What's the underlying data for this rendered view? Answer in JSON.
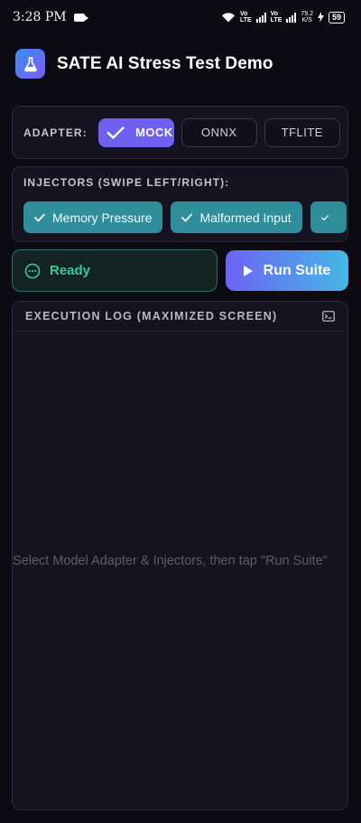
{
  "status_bar": {
    "time": "3:28 PM",
    "volte1": [
      "Vo",
      "LTE"
    ],
    "volte2": [
      "Vo",
      "LTE"
    ],
    "speed": [
      "79.2",
      "K/S"
    ],
    "battery": "59"
  },
  "header": {
    "title": "SATE AI Stress Test Demo",
    "logo_icon": "flask-icon"
  },
  "adapter": {
    "label": "ADAPTER:",
    "options": [
      {
        "label": "MOCK",
        "selected": true
      },
      {
        "label": "ONNX",
        "selected": false
      },
      {
        "label": "TFLITE",
        "selected": false
      }
    ]
  },
  "injectors": {
    "label": "INJECTORS (SWIPE LEFT/RIGHT):",
    "items": [
      {
        "label": "Memory Pressure",
        "selected": true
      },
      {
        "label": "Malformed Input",
        "selected": true
      },
      {
        "label": "",
        "selected": true
      }
    ]
  },
  "status": {
    "text": "Ready"
  },
  "run_button": {
    "label": "Run Suite"
  },
  "log": {
    "title": "EXECUTION LOG (MAXIMIZED SCREEN)",
    "placeholder": "Select Model Adapter & Injectors, then tap \"Run Suite\""
  },
  "colors": {
    "accent": "#7060f0",
    "injector": "#2f8e9c",
    "ready": "#35c99b",
    "background": "#0c0b13"
  }
}
